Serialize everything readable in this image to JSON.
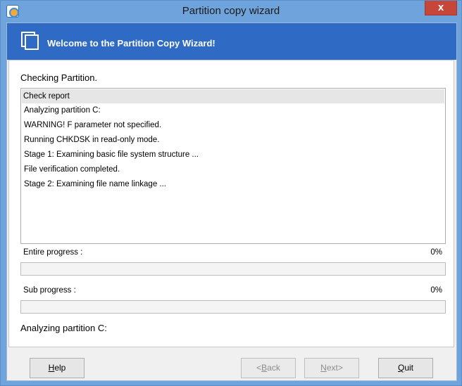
{
  "window": {
    "title": "Partition copy wizard",
    "close_glyph": "x"
  },
  "banner": {
    "title": "Welcome to the Partition Copy Wizard!",
    "icon": "pages-icon"
  },
  "main": {
    "heading": "Checking Partition.",
    "report": {
      "header": "Check report",
      "lines": [
        "Analyzing partition C:",
        "WARNING!  F parameter not specified.",
        "Running CHKDSK in read-only mode.",
        "Stage 1: Examining basic file system structure ...",
        "File verification completed.",
        "Stage 2: Examining file name linkage ..."
      ]
    },
    "entire_progress": {
      "label": "Entire progress :",
      "percent_text": "0%",
      "value": 0
    },
    "sub_progress": {
      "label": "Sub progress :",
      "percent_text": "0%",
      "value": 0
    },
    "status": "Analyzing partition C:"
  },
  "buttons": {
    "help": {
      "first": "H",
      "rest": "elp"
    },
    "back": {
      "first": "<",
      "u": "B",
      "rest": "ack"
    },
    "next": {
      "first": "N",
      "rest": "ext>"
    },
    "quit": {
      "first": "Q",
      "rest": "uit"
    }
  },
  "colors": {
    "banner": "#2f6bc4",
    "frame": "#6fa3dc",
    "close": "#c7463a"
  }
}
